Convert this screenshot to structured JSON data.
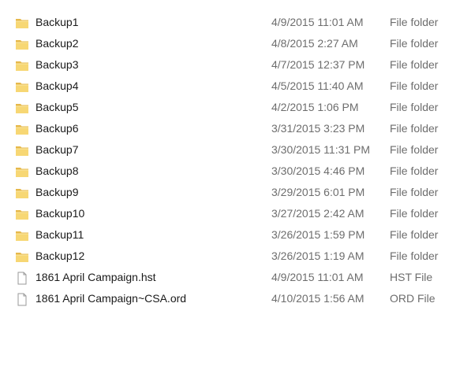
{
  "files": [
    {
      "name": "Backup1",
      "date": "4/9/2015 11:01 AM",
      "type": "File folder",
      "icon": "folder-icon"
    },
    {
      "name": "Backup2",
      "date": "4/8/2015 2:27 AM",
      "type": "File folder",
      "icon": "folder-icon"
    },
    {
      "name": "Backup3",
      "date": "4/7/2015 12:37 PM",
      "type": "File folder",
      "icon": "folder-icon"
    },
    {
      "name": "Backup4",
      "date": "4/5/2015 11:40 AM",
      "type": "File folder",
      "icon": "folder-icon"
    },
    {
      "name": "Backup5",
      "date": "4/2/2015 1:06 PM",
      "type": "File folder",
      "icon": "folder-icon"
    },
    {
      "name": "Backup6",
      "date": "3/31/2015 3:23 PM",
      "type": "File folder",
      "icon": "folder-icon"
    },
    {
      "name": "Backup7",
      "date": "3/30/2015 11:31 PM",
      "type": "File folder",
      "icon": "folder-icon"
    },
    {
      "name": "Backup8",
      "date": "3/30/2015 4:46 PM",
      "type": "File folder",
      "icon": "folder-icon"
    },
    {
      "name": "Backup9",
      "date": "3/29/2015 6:01 PM",
      "type": "File folder",
      "icon": "folder-icon"
    },
    {
      "name": "Backup10",
      "date": "3/27/2015 2:42 AM",
      "type": "File folder",
      "icon": "folder-icon"
    },
    {
      "name": "Backup11",
      "date": "3/26/2015 1:59 PM",
      "type": "File folder",
      "icon": "folder-icon"
    },
    {
      "name": "Backup12",
      "date": "3/26/2015 1:19 AM",
      "type": "File folder",
      "icon": "folder-icon"
    },
    {
      "name": "1861 April Campaign.hst",
      "date": "4/9/2015 11:01 AM",
      "type": "HST File",
      "icon": "file-icon"
    },
    {
      "name": "1861 April Campaign~CSA.ord",
      "date": "4/10/2015 1:56 AM",
      "type": "ORD File",
      "icon": "file-icon"
    }
  ]
}
